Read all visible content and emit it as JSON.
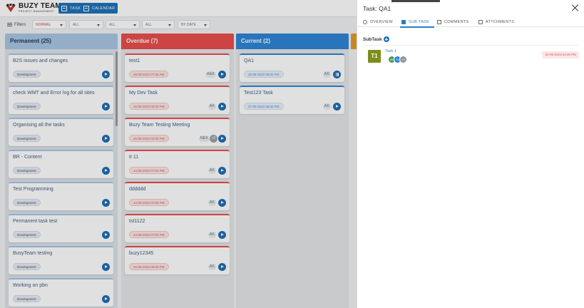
{
  "app": {
    "title": "BUZY TEAM",
    "subtitle": "PROJECT MANAGEMENT",
    "task_button": "TASK",
    "calendar_button": "CALENDAR"
  },
  "filters": {
    "label": "Filters",
    "selects": [
      "NORMAL",
      "ALL",
      "ALL",
      "ALL",
      "BY DATE"
    ]
  },
  "columns": [
    {
      "title": "Permanent (25)",
      "color": "#a9c7e3",
      "cards": [
        {
          "title": "B2S issues and changes",
          "chip": "Development"
        },
        {
          "title": "check WMT and Error log for all sites",
          "chip": "Development"
        },
        {
          "title": "Organising all the tasks",
          "chip": "Development"
        },
        {
          "title": "BR - Content",
          "chip": "Development"
        },
        {
          "title": "Test Programming",
          "chip": "Development"
        },
        {
          "title": "Permanent task test",
          "chip": "Development"
        },
        {
          "title": "BusyTeam testing",
          "chip": "Development"
        },
        {
          "title": "Working on pbn",
          "chip": "Development"
        }
      ]
    },
    {
      "title": "Overdue (7)",
      "color": "#e94e4d",
      "cards": [
        {
          "title": "test1",
          "date": "28-09-2023 07:30 AM",
          "assignee": "A&K"
        },
        {
          "title": "My Dev Task",
          "date": "16-05-2023 05:00 PM",
          "assignee": "AK"
        },
        {
          "title": "Buzy Team Testing Meeting",
          "date": "30-05-2023 02:00 PM",
          "assignee": "NEK",
          "extra": "+2"
        },
        {
          "title": "tt 11",
          "date": "14-05-2023 07:00 PM",
          "assignee": "AK"
        },
        {
          "title": "dddddd",
          "date": "14-05-2023 07:00 PM",
          "assignee": "AK"
        },
        {
          "title": "tst1122",
          "date": "14-05-2023 07:00 PM",
          "assignee": "AK"
        },
        {
          "title": "buzy12345",
          "date": "15-05-2023 05:00 PM",
          "assignee": "AK"
        }
      ]
    },
    {
      "title": "Current (2)",
      "color": "#2e86d6",
      "cards": [
        {
          "title": "QA1",
          "date": "25-05-2023 05:00 PM",
          "assignee": "AK"
        },
        {
          "title": "Test123 Task",
          "date": "27-05-2023 05:00 PM",
          "assignee": "AK"
        }
      ]
    }
  ],
  "panel": {
    "title_prefix": "Task:",
    "title_value": "QA1",
    "tabs": [
      "OVERVIEW",
      "SUB TASK",
      "COMMENTS",
      "ATTCHMENTS"
    ],
    "subtask_label": "SubTask",
    "subtask": {
      "badge": "T1",
      "name": "Task 1",
      "date": "20-05-2023 04:00 PM",
      "avatars": [
        "AK",
        "N",
        "+2"
      ]
    }
  },
  "colors": {
    "accent": "#1e72b8",
    "overdue": "#e94e4d",
    "current": "#2e86d6",
    "permanent": "#a9c7e3",
    "subtask_badge": "#7d8d1b"
  }
}
